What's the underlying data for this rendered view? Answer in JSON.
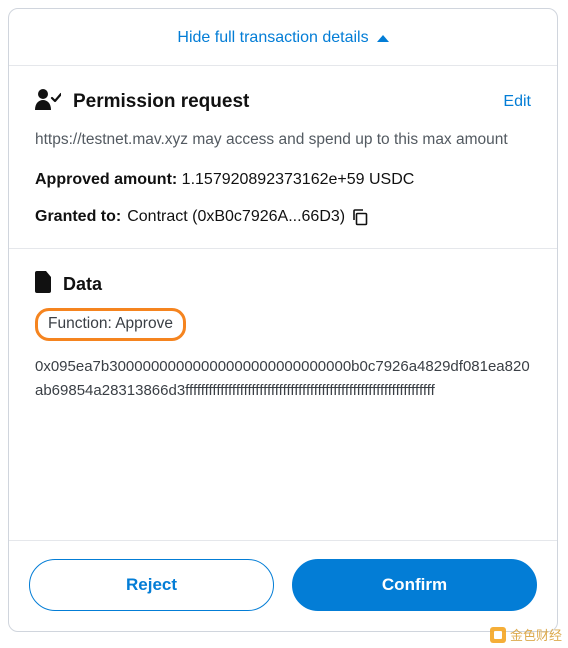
{
  "toggle": {
    "label": "Hide full transaction details"
  },
  "permission": {
    "title": "Permission request",
    "edit": "Edit",
    "description": "https://testnet.mav.xyz may access and spend up to this max amount",
    "approved_label": "Approved amount:",
    "approved_value": "1.157920892373162e+59 USDC",
    "granted_label": "Granted to:",
    "granted_value": "Contract (0xB0c7926A...66D3)"
  },
  "data": {
    "title": "Data",
    "function_label": "Function: Approve",
    "hex": "0x095ea7b30000000000000000000000000000b0c7926a4829df081ea820ab69854a28313866d3ffffffffffffffffffffffffffffffffffffffffffffffffffffffffffffffff"
  },
  "actions": {
    "reject": "Reject",
    "confirm": "Confirm"
  },
  "watermark": "金色财经",
  "colors": {
    "primary": "#037dd6",
    "highlight_border": "#f5841f"
  }
}
